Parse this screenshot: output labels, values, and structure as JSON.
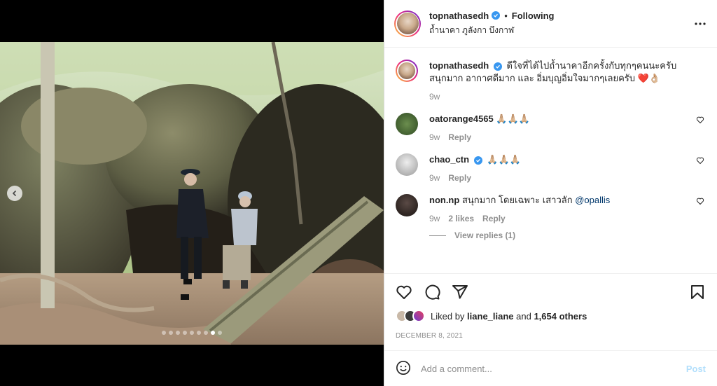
{
  "post": {
    "username": "topnathasedh",
    "separator": "•",
    "follow_status": "Following",
    "location": "ถ้ำนาคา ภูลังกา บึงกาฬ",
    "more_icon": "more-horizontal-icon",
    "caption": "ดีใจที่ได้ไปถ้ำนาคาอีกครั้งกับทุกๆคนนะครับ สนุกมาก อากาศดีมาก และ อิ่มบุญอิ่มใจมากๆเลยครับ ❤️👌🏼",
    "caption_time": "9w"
  },
  "carousel": {
    "dot_count": 9,
    "active_index": 7
  },
  "comments": [
    {
      "username": "oatorange4565",
      "text": "🙏🏼🙏🏼🙏🏼",
      "verified": false,
      "time": "9w",
      "likes": "",
      "reply": "Reply"
    },
    {
      "username": "chao_ctn",
      "text": "🙏🏼🙏🏼🙏🏼",
      "verified": true,
      "time": "9w",
      "likes": "",
      "reply": "Reply"
    },
    {
      "username": "non.np",
      "text": "สนุกมาก โดยเฉพาะ เสาวลัก ",
      "mention": "@opallis",
      "verified": false,
      "time": "9w",
      "likes": "2 likes",
      "reply": "Reply"
    }
  ],
  "view_replies": "View replies (1)",
  "likes": {
    "prefix": "Liked by ",
    "user": "liane_liane",
    "middle": " and ",
    "others": "1,654 others"
  },
  "date": "DECEMBER 8, 2021",
  "add_comment": {
    "placeholder": "Add a comment...",
    "post_label": "Post"
  },
  "colors": {
    "verified": "#3897f0",
    "post_disabled": "#b2dffc",
    "mention": "#00376b"
  }
}
